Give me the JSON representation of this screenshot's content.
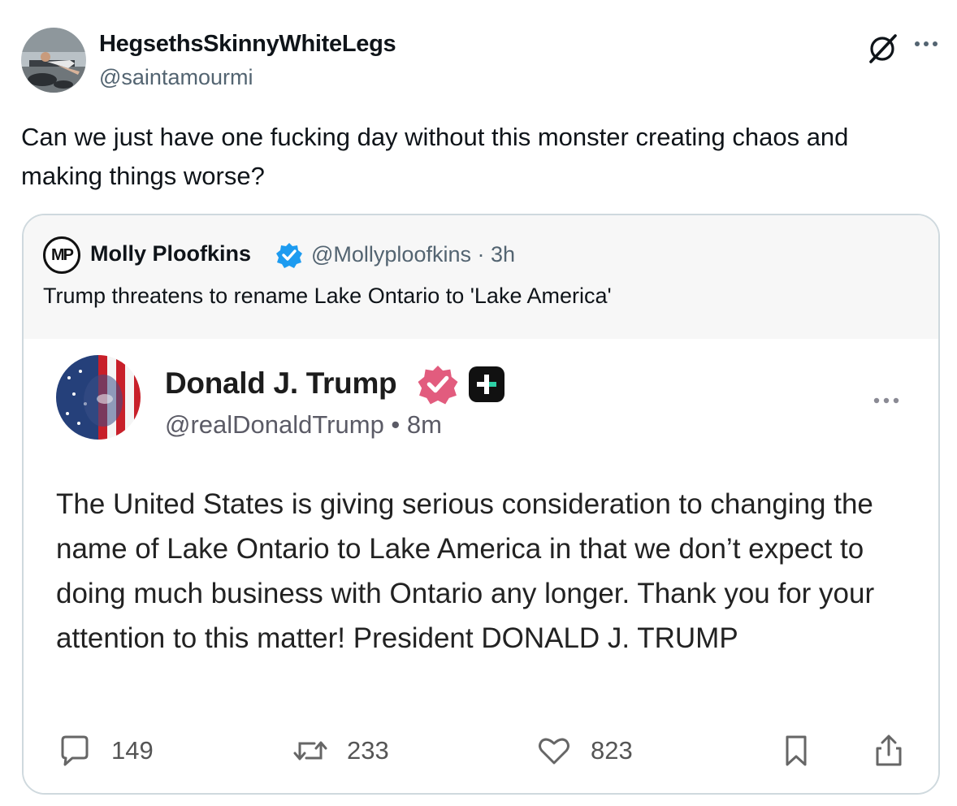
{
  "post": {
    "author_name": "HegsethsSkinnyWhiteLegs",
    "author_handle": "@saintamourmi",
    "text": "Can we just have one fucking day without this monster creating chaos and making things worse?"
  },
  "quote": {
    "avatar_initials": "MP",
    "author_name": "Molly Ploofkins",
    "author_handle": "@Mollyploofkins · 3h",
    "text": "Trump threatens to rename Lake Ontario to 'Lake America'",
    "embedded": {
      "author_name": "Donald J. Trump",
      "author_handle": "@realDonaldTrump • 8m",
      "text": "The United States is giving serious consideration to changing the name of Lake Ontario to Lake America in that we don’t expect to doing much business with Ontario any longer. Thank you for your attention to this matter! President DONALD J. TRUMP",
      "replies": "149",
      "retruths": "233",
      "likes": "823"
    }
  },
  "colors": {
    "verified_blue": "#1d9bf0",
    "verified_pink": "#e25c7e",
    "muted_text": "#536471",
    "border": "#cfd9de"
  },
  "icons": [
    "grok-icon",
    "more-icon",
    "verified-badge-icon",
    "plus-badge-icon",
    "reply-icon",
    "retruth-icon",
    "heart-icon",
    "bookmark-icon",
    "share-icon"
  ]
}
